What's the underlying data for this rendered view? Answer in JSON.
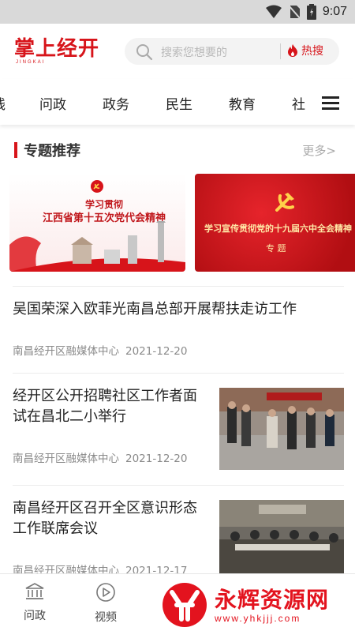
{
  "status_bar": {
    "time": "9:07"
  },
  "header": {
    "logo_text": "掌上经开",
    "logo_sub": "JINGKAI",
    "search_placeholder": "搜索您想要的",
    "hot_label": "热搜"
  },
  "tabs": [
    {
      "label": "线"
    },
    {
      "label": "问政"
    },
    {
      "label": "政务"
    },
    {
      "label": "民生"
    },
    {
      "label": "教育"
    },
    {
      "label": "社"
    }
  ],
  "section": {
    "title": "专题推荐",
    "more": "更多>"
  },
  "banners": [
    {
      "line1": "学习贯彻",
      "line2": "江西省第十五次党代会精神"
    },
    {
      "line1": "学习宣传贯彻党的十九届六中全会精神",
      "line2": "专 题"
    }
  ],
  "news": [
    {
      "title": "吴国荣深入欧菲光南昌总部开展帮扶走访工作",
      "source": "南昌经开区融媒体中心",
      "date": "2021-12-20",
      "has_image": false
    },
    {
      "title": "经开区公开招聘社区工作者面试在昌北二小举行",
      "source": "南昌经开区融媒体中心",
      "date": "2021-12-20",
      "has_image": true
    },
    {
      "title": "南昌经开区召开全区意识形态工作联席会议",
      "source": "南昌经开区融媒体中心",
      "date": "2021-12-17",
      "has_image": true
    }
  ],
  "bottom_nav": [
    {
      "label": "问政",
      "icon": "government-building-icon"
    },
    {
      "label": "视频",
      "icon": "play-circle-icon"
    }
  ],
  "watermark": {
    "text": "永辉资源网",
    "url": "www.yhkjjj.com"
  },
  "colors": {
    "brand": "#d7141a",
    "muted": "#8a8a8a",
    "search_bg": "#f3f3f3"
  }
}
